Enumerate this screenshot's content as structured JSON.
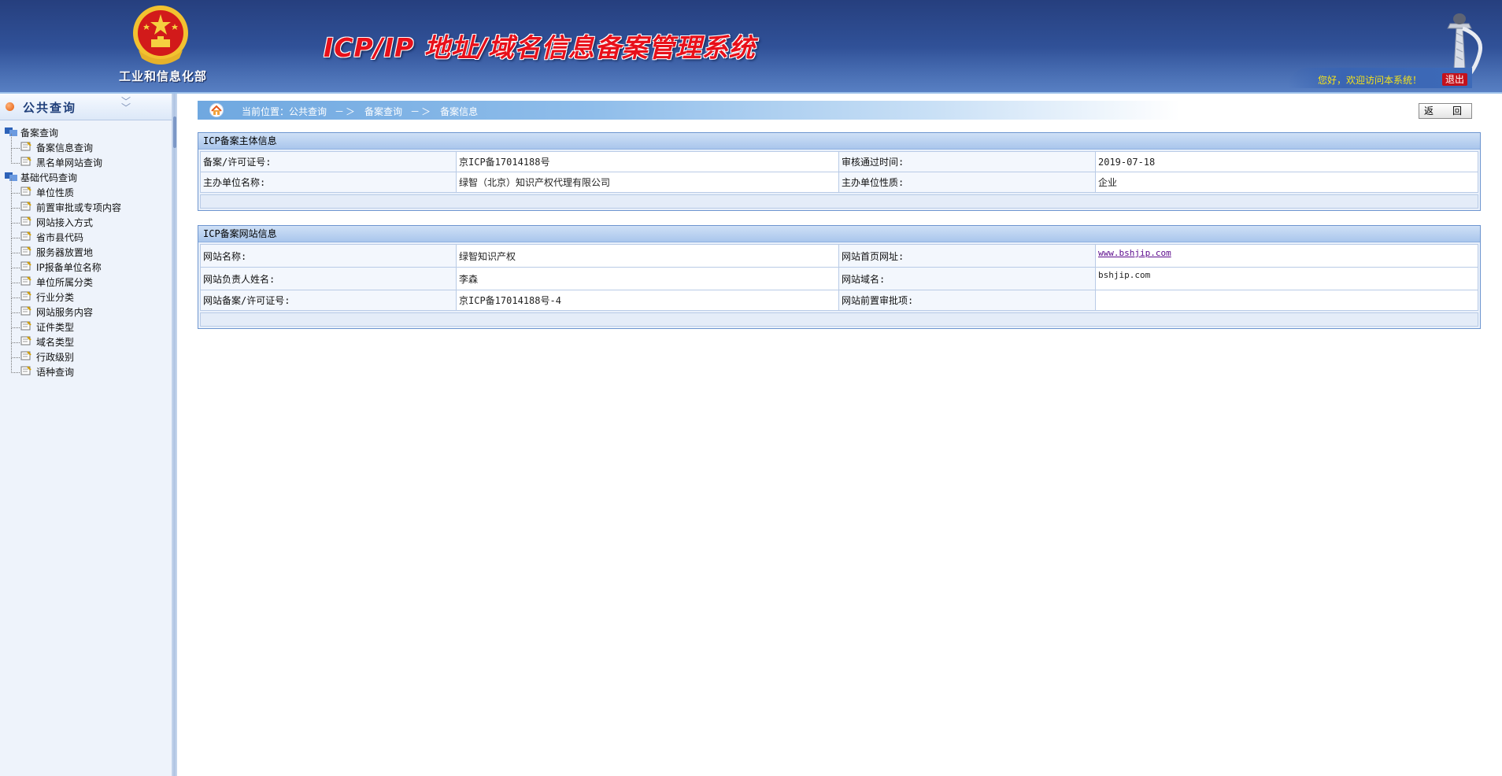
{
  "header": {
    "ministry": "工业和信息化部",
    "system_title": "ICP/IP 地址/域名信息备案管理系统",
    "welcome": "您好，欢迎访问本系统！",
    "logout_label": "退出",
    "icons": [
      "national-emblem",
      "huabiao-pillar"
    ],
    "colors": {
      "title_red": "#e8101a",
      "header_blue": "#2f4f95",
      "welcome_yellow": "#f5e21a"
    }
  },
  "sidebar": {
    "title": "公共查询",
    "groups": [
      {
        "label": "备案查询",
        "items": [
          "备案信息查询",
          "黑名单网站查询"
        ]
      },
      {
        "label": "基础代码查询",
        "items": [
          "单位性质",
          "前置审批或专项内容",
          "网站接入方式",
          "省市县代码",
          "服务器放置地",
          "IP报备单位名称",
          "单位所属分类",
          "行业分类",
          "网站服务内容",
          "证件类型",
          "域名类型",
          "行政级别",
          "语种查询"
        ]
      }
    ]
  },
  "breadcrumb": {
    "prefix": "当前位置：",
    "items": [
      "公共查询",
      "备案查询",
      "备案信息"
    ],
    "separator": "－＞"
  },
  "back_label": "返　回",
  "subject_panel": {
    "title": "ICP备案主体信息",
    "rows": [
      {
        "label1": "备案/许可证号:",
        "value1": "京ICP备17014188号",
        "label2": "审核通过时间:",
        "value2": "2019-07-18"
      },
      {
        "label1": "主办单位名称:",
        "value1": "绿智（北京）知识产权代理有限公司",
        "label2": "主办单位性质:",
        "value2": "企业"
      }
    ]
  },
  "site_panel": {
    "title": "ICP备案网站信息",
    "rows": [
      {
        "label1": "网站名称:",
        "value1": "绿智知识产权",
        "label2": "网站首页网址:",
        "value2": "www.bshjip.com"
      },
      {
        "label1": "网站负责人姓名:",
        "value1": "李森",
        "label2": "网站域名:",
        "value2": "bshjip.com"
      },
      {
        "label1": "网站备案/许可证号:",
        "value1": "京ICP备17014188号-4",
        "label2": "网站前置审批项:",
        "value2": ""
      }
    ]
  }
}
